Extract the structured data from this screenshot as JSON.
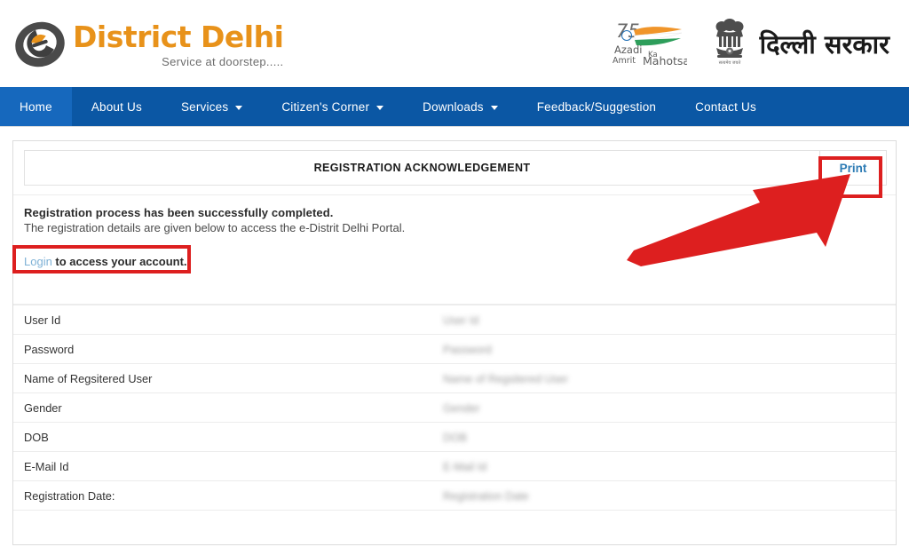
{
  "header": {
    "brand_title": "District Delhi",
    "brand_tagline": "Service at doorstep.....",
    "logo_icon": "e-district-logo-icon",
    "azadi_logo": {
      "icon": "azadi-ka-amrit-mahotsav-icon",
      "line1": "Azadi",
      "line2": "Ka",
      "line3": "Amrit",
      "line4": "Mahotsav",
      "numeral": "75"
    },
    "emblem_icon": "ashoka-emblem-icon",
    "emblem_caption": "सत्यमेव जयते",
    "govt_title": "दिल्ली सरकार"
  },
  "nav": {
    "items": [
      {
        "label": "Home",
        "active": true,
        "has_caret": false
      },
      {
        "label": "About Us",
        "active": false,
        "has_caret": false
      },
      {
        "label": "Services",
        "active": false,
        "has_caret": true
      },
      {
        "label": "Citizen's Corner",
        "active": false,
        "has_caret": true
      },
      {
        "label": "Downloads",
        "active": false,
        "has_caret": true
      },
      {
        "label": "Feedback/Suggestion",
        "active": false,
        "has_caret": false
      },
      {
        "label": "Contact Us",
        "active": false,
        "has_caret": false
      }
    ]
  },
  "acknowledgement": {
    "title": "REGISTRATION ACKNOWLEDGEMENT",
    "print_label": "Print",
    "success_message": "Registration process has been successfully completed.",
    "detail_message": "The registration details are given below to access the e-Distrit Delhi Portal.",
    "login_link_label": "Login",
    "login_rest_text": " to access your account."
  },
  "details": {
    "rows": [
      {
        "label": "User Id",
        "value": "User Id"
      },
      {
        "label": "Password",
        "value": "Password"
      },
      {
        "label": "Name of Regsitered User",
        "value": "Name of Regsitered User"
      },
      {
        "label": "Gender",
        "value": "Gender"
      },
      {
        "label": "DOB",
        "value": "DOB"
      },
      {
        "label": "E-Mail Id",
        "value": "E-Mail Id"
      },
      {
        "label": "Registration Date:",
        "value": "Registration Date"
      }
    ]
  },
  "annotations": {
    "print_highlight": "red-box-around-print-button",
    "login_highlight": "red-box-around-login-link",
    "arrow": "red-arrow-pointing-to-print-button",
    "color": "#dd1f1f"
  },
  "colors": {
    "nav_background": "#0b57a4",
    "nav_active": "#1668bd",
    "brand_orange": "#E8921A",
    "print_blue": "#2e7cb5",
    "login_blue": "#7fb2d6",
    "annotation_red": "#dd1f1f"
  }
}
